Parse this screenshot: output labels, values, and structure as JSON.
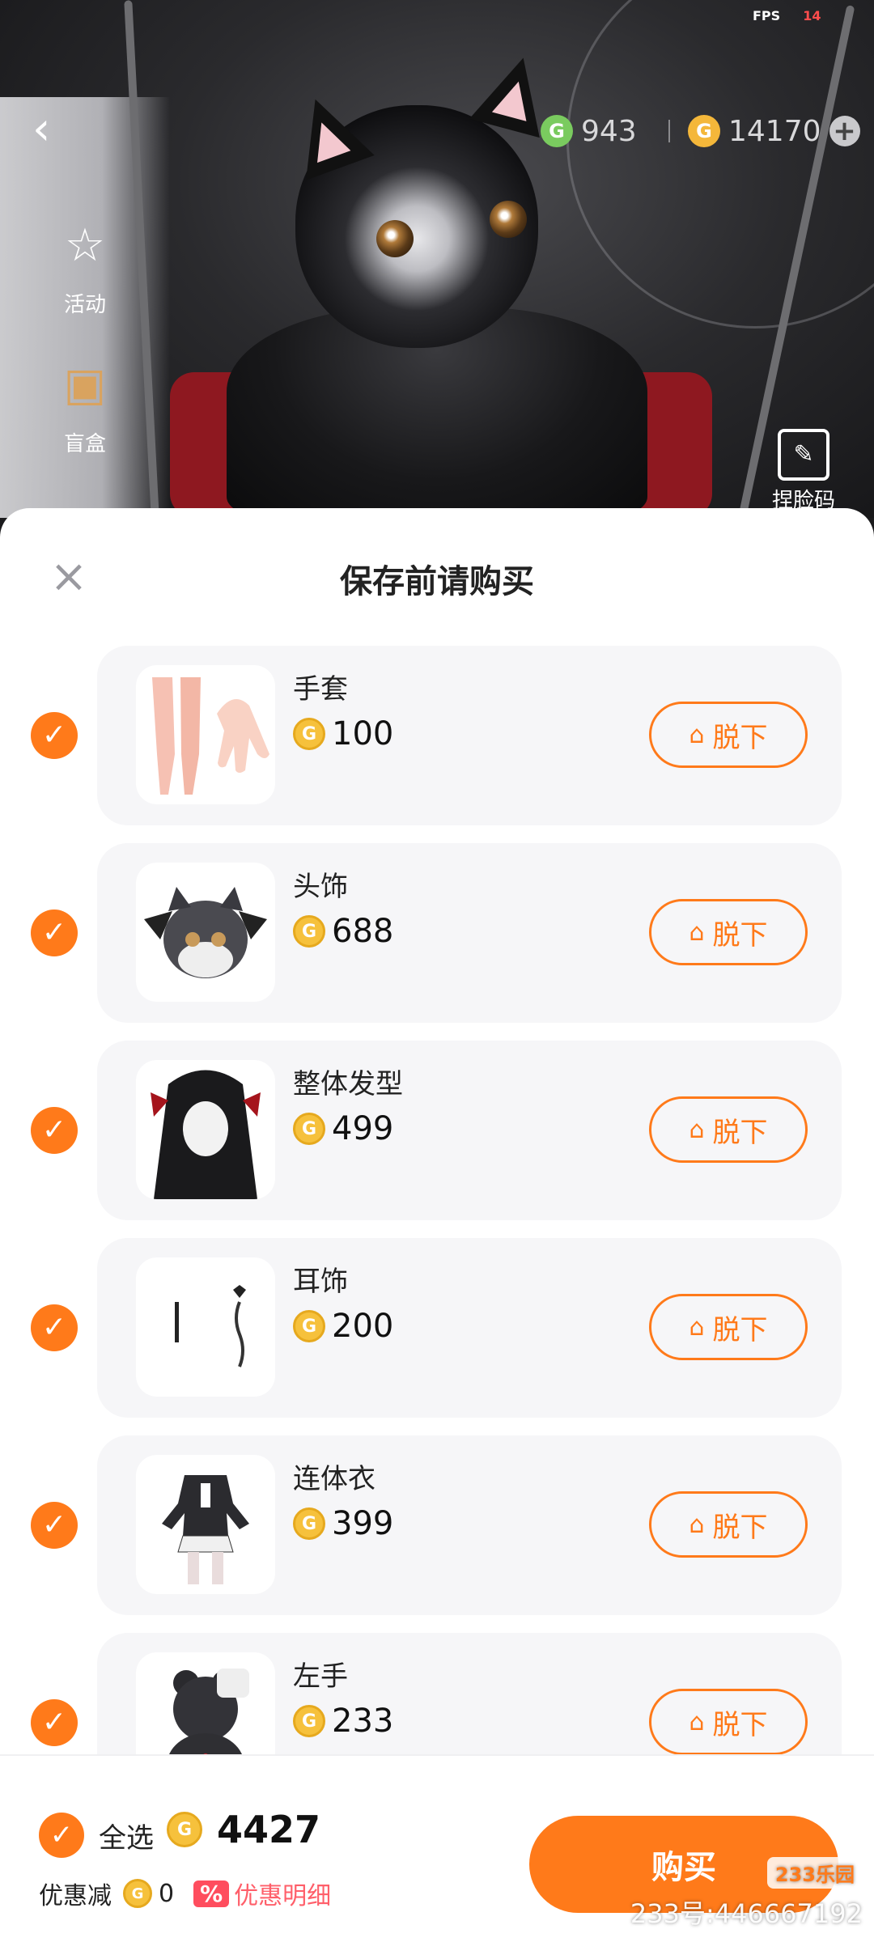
{
  "status": {
    "fps_label": "FPS",
    "fps_value": "14"
  },
  "top_bar": {
    "currency_green": {
      "icon": "g-coin-green-icon",
      "value": "943"
    },
    "currency_gold": {
      "icon": "g-coin-gold-icon",
      "value": "14170"
    },
    "add_icon": "plus-icon"
  },
  "side_menu": [
    {
      "label": "活动",
      "icon": "activity-star-icon"
    },
    {
      "label": "盲盒",
      "icon": "gift-box-icon"
    }
  ],
  "face_code": {
    "label": "捏脸码",
    "icon": "edit-icon"
  },
  "sheet": {
    "title": "保存前请购买",
    "close_icon": "close-icon",
    "item_action_label": "脱下",
    "items": [
      {
        "name": "手套",
        "price": "100"
      },
      {
        "name": "头饰",
        "price": "688"
      },
      {
        "name": "整体发型",
        "price": "499"
      },
      {
        "name": "耳饰",
        "price": "200"
      },
      {
        "name": "连体衣",
        "price": "399"
      },
      {
        "name": "左手",
        "price": "233"
      }
    ]
  },
  "footer": {
    "select_all_label": "全选",
    "total": "4427",
    "discount_label": "优惠减",
    "discount_value": "0",
    "detail_badge": "%",
    "detail_label": "优惠明细",
    "buy_label": "购买"
  },
  "watermark": {
    "logo": "233乐园",
    "text": "233号:446667192"
  },
  "colors": {
    "accent": "#ff7a1a",
    "coin": "#f6c13c",
    "card_bg": "#f6f6f8"
  }
}
